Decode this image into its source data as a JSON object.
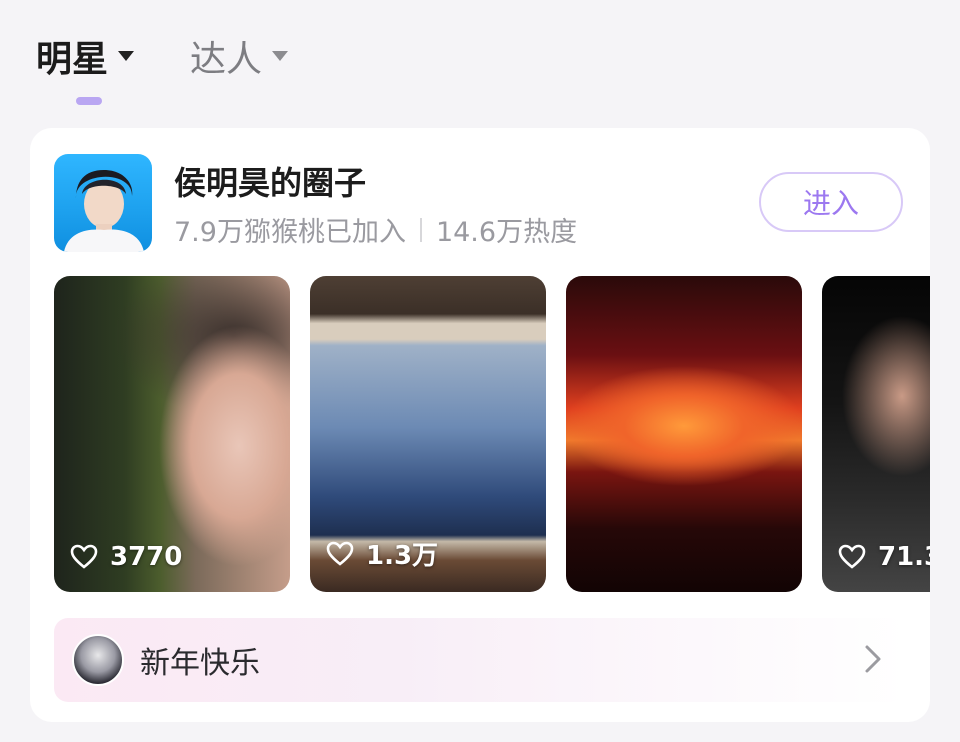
{
  "tabs": [
    {
      "label": "明星",
      "active": true
    },
    {
      "label": "达人",
      "active": false
    }
  ],
  "circle": {
    "name": "侯明昊的圈子",
    "members": "7.9万猕猴桃已加入",
    "heat": "14.6万热度",
    "join_label": "进入"
  },
  "posts": [
    {
      "likes": "3770"
    },
    {
      "likes": "1.3万"
    },
    {
      "likes": ""
    },
    {
      "likes": "71.3"
    }
  ],
  "news": {
    "text": "新年快乐"
  },
  "colors": {
    "accent": "#9c78f0",
    "indicator": "#b9a6f2",
    "background": "#f5f4f7"
  },
  "icons": {
    "tab_caret": "caret-down-icon",
    "like": "heart-outline-icon",
    "chevron": "chevron-right-icon"
  }
}
